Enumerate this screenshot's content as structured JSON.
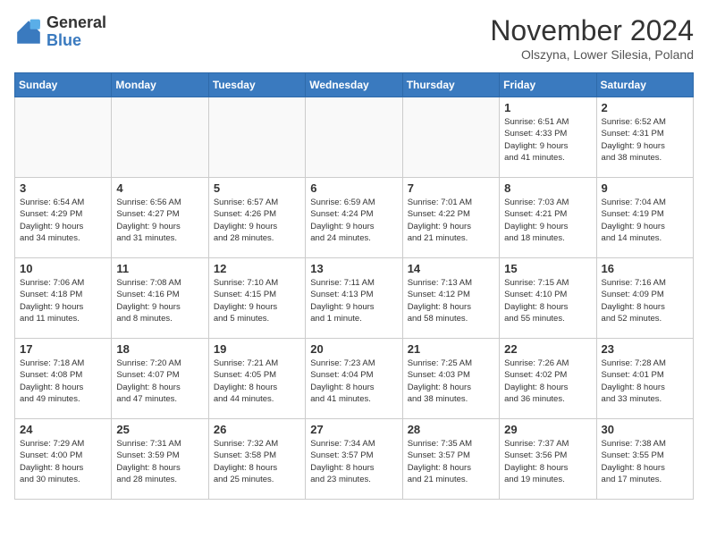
{
  "header": {
    "logo_general": "General",
    "logo_blue": "Blue",
    "month_title": "November 2024",
    "subtitle": "Olszyna, Lower Silesia, Poland"
  },
  "weekdays": [
    "Sunday",
    "Monday",
    "Tuesday",
    "Wednesday",
    "Thursday",
    "Friday",
    "Saturday"
  ],
  "weeks": [
    [
      {
        "day": "",
        "info": ""
      },
      {
        "day": "",
        "info": ""
      },
      {
        "day": "",
        "info": ""
      },
      {
        "day": "",
        "info": ""
      },
      {
        "day": "",
        "info": ""
      },
      {
        "day": "1",
        "info": "Sunrise: 6:51 AM\nSunset: 4:33 PM\nDaylight: 9 hours\nand 41 minutes."
      },
      {
        "day": "2",
        "info": "Sunrise: 6:52 AM\nSunset: 4:31 PM\nDaylight: 9 hours\nand 38 minutes."
      }
    ],
    [
      {
        "day": "3",
        "info": "Sunrise: 6:54 AM\nSunset: 4:29 PM\nDaylight: 9 hours\nand 34 minutes."
      },
      {
        "day": "4",
        "info": "Sunrise: 6:56 AM\nSunset: 4:27 PM\nDaylight: 9 hours\nand 31 minutes."
      },
      {
        "day": "5",
        "info": "Sunrise: 6:57 AM\nSunset: 4:26 PM\nDaylight: 9 hours\nand 28 minutes."
      },
      {
        "day": "6",
        "info": "Sunrise: 6:59 AM\nSunset: 4:24 PM\nDaylight: 9 hours\nand 24 minutes."
      },
      {
        "day": "7",
        "info": "Sunrise: 7:01 AM\nSunset: 4:22 PM\nDaylight: 9 hours\nand 21 minutes."
      },
      {
        "day": "8",
        "info": "Sunrise: 7:03 AM\nSunset: 4:21 PM\nDaylight: 9 hours\nand 18 minutes."
      },
      {
        "day": "9",
        "info": "Sunrise: 7:04 AM\nSunset: 4:19 PM\nDaylight: 9 hours\nand 14 minutes."
      }
    ],
    [
      {
        "day": "10",
        "info": "Sunrise: 7:06 AM\nSunset: 4:18 PM\nDaylight: 9 hours\nand 11 minutes."
      },
      {
        "day": "11",
        "info": "Sunrise: 7:08 AM\nSunset: 4:16 PM\nDaylight: 9 hours\nand 8 minutes."
      },
      {
        "day": "12",
        "info": "Sunrise: 7:10 AM\nSunset: 4:15 PM\nDaylight: 9 hours\nand 5 minutes."
      },
      {
        "day": "13",
        "info": "Sunrise: 7:11 AM\nSunset: 4:13 PM\nDaylight: 9 hours\nand 1 minute."
      },
      {
        "day": "14",
        "info": "Sunrise: 7:13 AM\nSunset: 4:12 PM\nDaylight: 8 hours\nand 58 minutes."
      },
      {
        "day": "15",
        "info": "Sunrise: 7:15 AM\nSunset: 4:10 PM\nDaylight: 8 hours\nand 55 minutes."
      },
      {
        "day": "16",
        "info": "Sunrise: 7:16 AM\nSunset: 4:09 PM\nDaylight: 8 hours\nand 52 minutes."
      }
    ],
    [
      {
        "day": "17",
        "info": "Sunrise: 7:18 AM\nSunset: 4:08 PM\nDaylight: 8 hours\nand 49 minutes."
      },
      {
        "day": "18",
        "info": "Sunrise: 7:20 AM\nSunset: 4:07 PM\nDaylight: 8 hours\nand 47 minutes."
      },
      {
        "day": "19",
        "info": "Sunrise: 7:21 AM\nSunset: 4:05 PM\nDaylight: 8 hours\nand 44 minutes."
      },
      {
        "day": "20",
        "info": "Sunrise: 7:23 AM\nSunset: 4:04 PM\nDaylight: 8 hours\nand 41 minutes."
      },
      {
        "day": "21",
        "info": "Sunrise: 7:25 AM\nSunset: 4:03 PM\nDaylight: 8 hours\nand 38 minutes."
      },
      {
        "day": "22",
        "info": "Sunrise: 7:26 AM\nSunset: 4:02 PM\nDaylight: 8 hours\nand 36 minutes."
      },
      {
        "day": "23",
        "info": "Sunrise: 7:28 AM\nSunset: 4:01 PM\nDaylight: 8 hours\nand 33 minutes."
      }
    ],
    [
      {
        "day": "24",
        "info": "Sunrise: 7:29 AM\nSunset: 4:00 PM\nDaylight: 8 hours\nand 30 minutes."
      },
      {
        "day": "25",
        "info": "Sunrise: 7:31 AM\nSunset: 3:59 PM\nDaylight: 8 hours\nand 28 minutes."
      },
      {
        "day": "26",
        "info": "Sunrise: 7:32 AM\nSunset: 3:58 PM\nDaylight: 8 hours\nand 25 minutes."
      },
      {
        "day": "27",
        "info": "Sunrise: 7:34 AM\nSunset: 3:57 PM\nDaylight: 8 hours\nand 23 minutes."
      },
      {
        "day": "28",
        "info": "Sunrise: 7:35 AM\nSunset: 3:57 PM\nDaylight: 8 hours\nand 21 minutes."
      },
      {
        "day": "29",
        "info": "Sunrise: 7:37 AM\nSunset: 3:56 PM\nDaylight: 8 hours\nand 19 minutes."
      },
      {
        "day": "30",
        "info": "Sunrise: 7:38 AM\nSunset: 3:55 PM\nDaylight: 8 hours\nand 17 minutes."
      }
    ]
  ]
}
